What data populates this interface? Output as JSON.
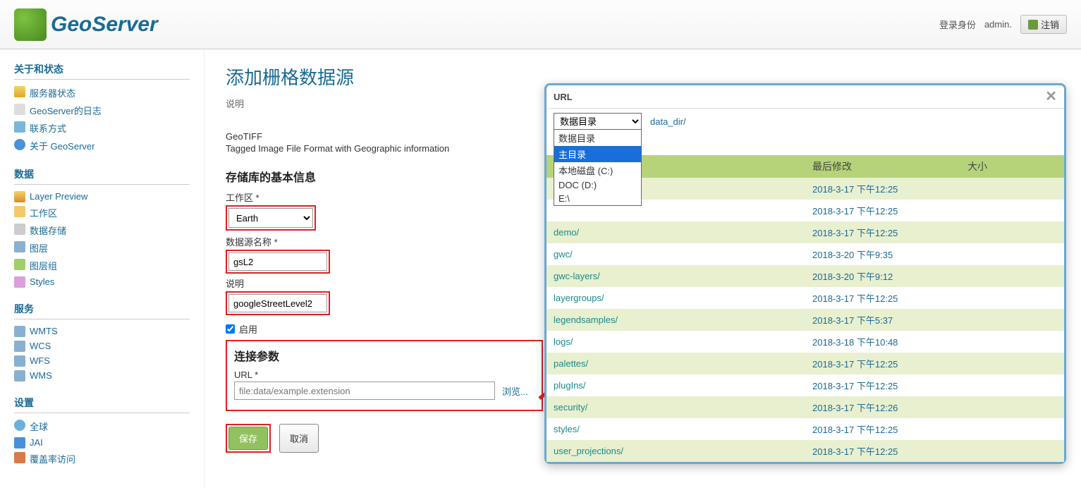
{
  "header": {
    "logo_text": "GeoServer",
    "login_label": "登录身份",
    "username": "admin.",
    "logout_label": "注销"
  },
  "sidebar": {
    "about": {
      "title": "关于和状态",
      "items": [
        {
          "label": "服务器状态"
        },
        {
          "label": "GeoServer的日志"
        },
        {
          "label": "联系方式"
        },
        {
          "label": "关于 GeoServer"
        }
      ]
    },
    "data": {
      "title": "数据",
      "items": [
        {
          "label": "Layer Preview"
        },
        {
          "label": "工作区"
        },
        {
          "label": "数据存储"
        },
        {
          "label": "图层"
        },
        {
          "label": "图层组"
        },
        {
          "label": "Styles"
        }
      ]
    },
    "services": {
      "title": "服务",
      "items": [
        {
          "label": "WMTS"
        },
        {
          "label": "WCS"
        },
        {
          "label": "WFS"
        },
        {
          "label": "WMS"
        }
      ]
    },
    "settings": {
      "title": "设置",
      "items": [
        {
          "label": "全球"
        },
        {
          "label": "JAI"
        },
        {
          "label": "覆盖率访问"
        }
      ]
    }
  },
  "main": {
    "title": "添加栅格数据源",
    "subtitle": "说明",
    "format_name": "GeoTIFF",
    "format_desc": "Tagged Image File Format with Geographic information",
    "basic_section": "存储库的基本信息",
    "workspace_label": "工作区 *",
    "workspace_value": "Earth",
    "datasource_label": "数据源名称 *",
    "datasource_value": "gsL2",
    "desc_label": "说明",
    "desc_value": "googleStreetLevel2",
    "enable_label": "启用",
    "conn_section": "连接参数",
    "url_label": "URL *",
    "url_placeholder": "file:data/example.extension",
    "browse_label": "浏览...",
    "save_label": "保存",
    "cancel_label": "取消"
  },
  "dialog": {
    "title": "URL",
    "selected_dir": "数据目录",
    "options": [
      "数据目录",
      "主目录",
      "本地磁盘 (C:)",
      "DOC (D:)",
      "E:\\"
    ],
    "selected_option_index": 1,
    "breadcrumb": "data_dir/",
    "columns": {
      "name": "",
      "modified": "最后修改",
      "size": "大小"
    },
    "rows": [
      {
        "name": "",
        "date": "2018-3-17 下午12:25"
      },
      {
        "name": "",
        "date": "2018-3-17 下午12:25"
      },
      {
        "name": "demo/",
        "date": "2018-3-17 下午12:25"
      },
      {
        "name": "gwc/",
        "date": "2018-3-20 下午9:35"
      },
      {
        "name": "gwc-layers/",
        "date": "2018-3-20 下午9:12"
      },
      {
        "name": "layergroups/",
        "date": "2018-3-17 下午12:25"
      },
      {
        "name": "legendsamples/",
        "date": "2018-3-17 下午5:37"
      },
      {
        "name": "logs/",
        "date": "2018-3-18 下午10:48"
      },
      {
        "name": "palettes/",
        "date": "2018-3-17 下午12:25"
      },
      {
        "name": "plugIns/",
        "date": "2018-3-17 下午12:25"
      },
      {
        "name": "security/",
        "date": "2018-3-17 下午12:26"
      },
      {
        "name": "styles/",
        "date": "2018-3-17 下午12:25"
      },
      {
        "name": "user_projections/",
        "date": "2018-3-17 下午12:25"
      }
    ]
  }
}
